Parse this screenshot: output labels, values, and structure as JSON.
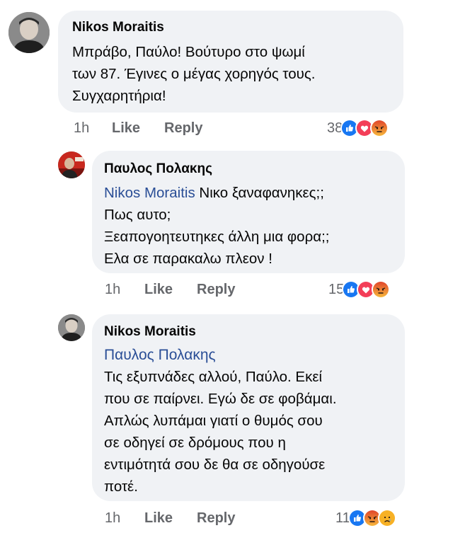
{
  "comments": [
    {
      "author": "Nikos Moraitis",
      "lines": [
        "Μπράβο, Παύλο! Βούτυρο στο ψωμί",
        "των 87. Έγινες ο μέγας χορηγός τους.",
        "Συγχαρητήρια!"
      ],
      "time": "1h",
      "like_label": "Like",
      "reply_label": "Reply",
      "reaction_count": "38",
      "reactions": [
        "like-icon",
        "love-icon",
        "angry-icon"
      ]
    },
    {
      "author": "Παυλος Πολακης",
      "mention": "Nikos Moraitis",
      "first_line_rest": " Νικο ξαναφανηκες;;",
      "lines": [
        "Πως αυτο;",
        "Ξεαπογοητευτηκες άλλη μια φορα;;",
        "Ελα σε παρακαλω πλεον !"
      ],
      "time": "1h",
      "like_label": "Like",
      "reply_label": "Reply",
      "reaction_count": "15",
      "reactions": [
        "like-icon",
        "love-icon",
        "angry-icon"
      ]
    },
    {
      "author": "Nikos Moraitis",
      "mention": "Παυλος Πολακης",
      "lines": [
        "Τις εξυπνάδες αλλού, Παύλο. Εκεί",
        "που σε παίρνει. Εγώ δε σε φοβάμαι.",
        "Απλώς λυπάμαι γιατί ο θυμός σου",
        "σε οδηγεί σε δρόμους που η",
        "εντιμότητά σου δε θα σε οδηγούσε",
        "ποτέ."
      ],
      "time": "1h",
      "like_label": "Like",
      "reply_label": "Reply",
      "reaction_count": "11",
      "reactions": [
        "like-icon",
        "angry-icon",
        "sad-icon"
      ]
    }
  ],
  "colors": {
    "bubble": "#f0f2f5",
    "mention": "#2a4e96",
    "meta": "#65676b",
    "like": "#1877f2",
    "love": "#f33e58",
    "angry": "#e9710f",
    "sad": "#f7b125"
  }
}
